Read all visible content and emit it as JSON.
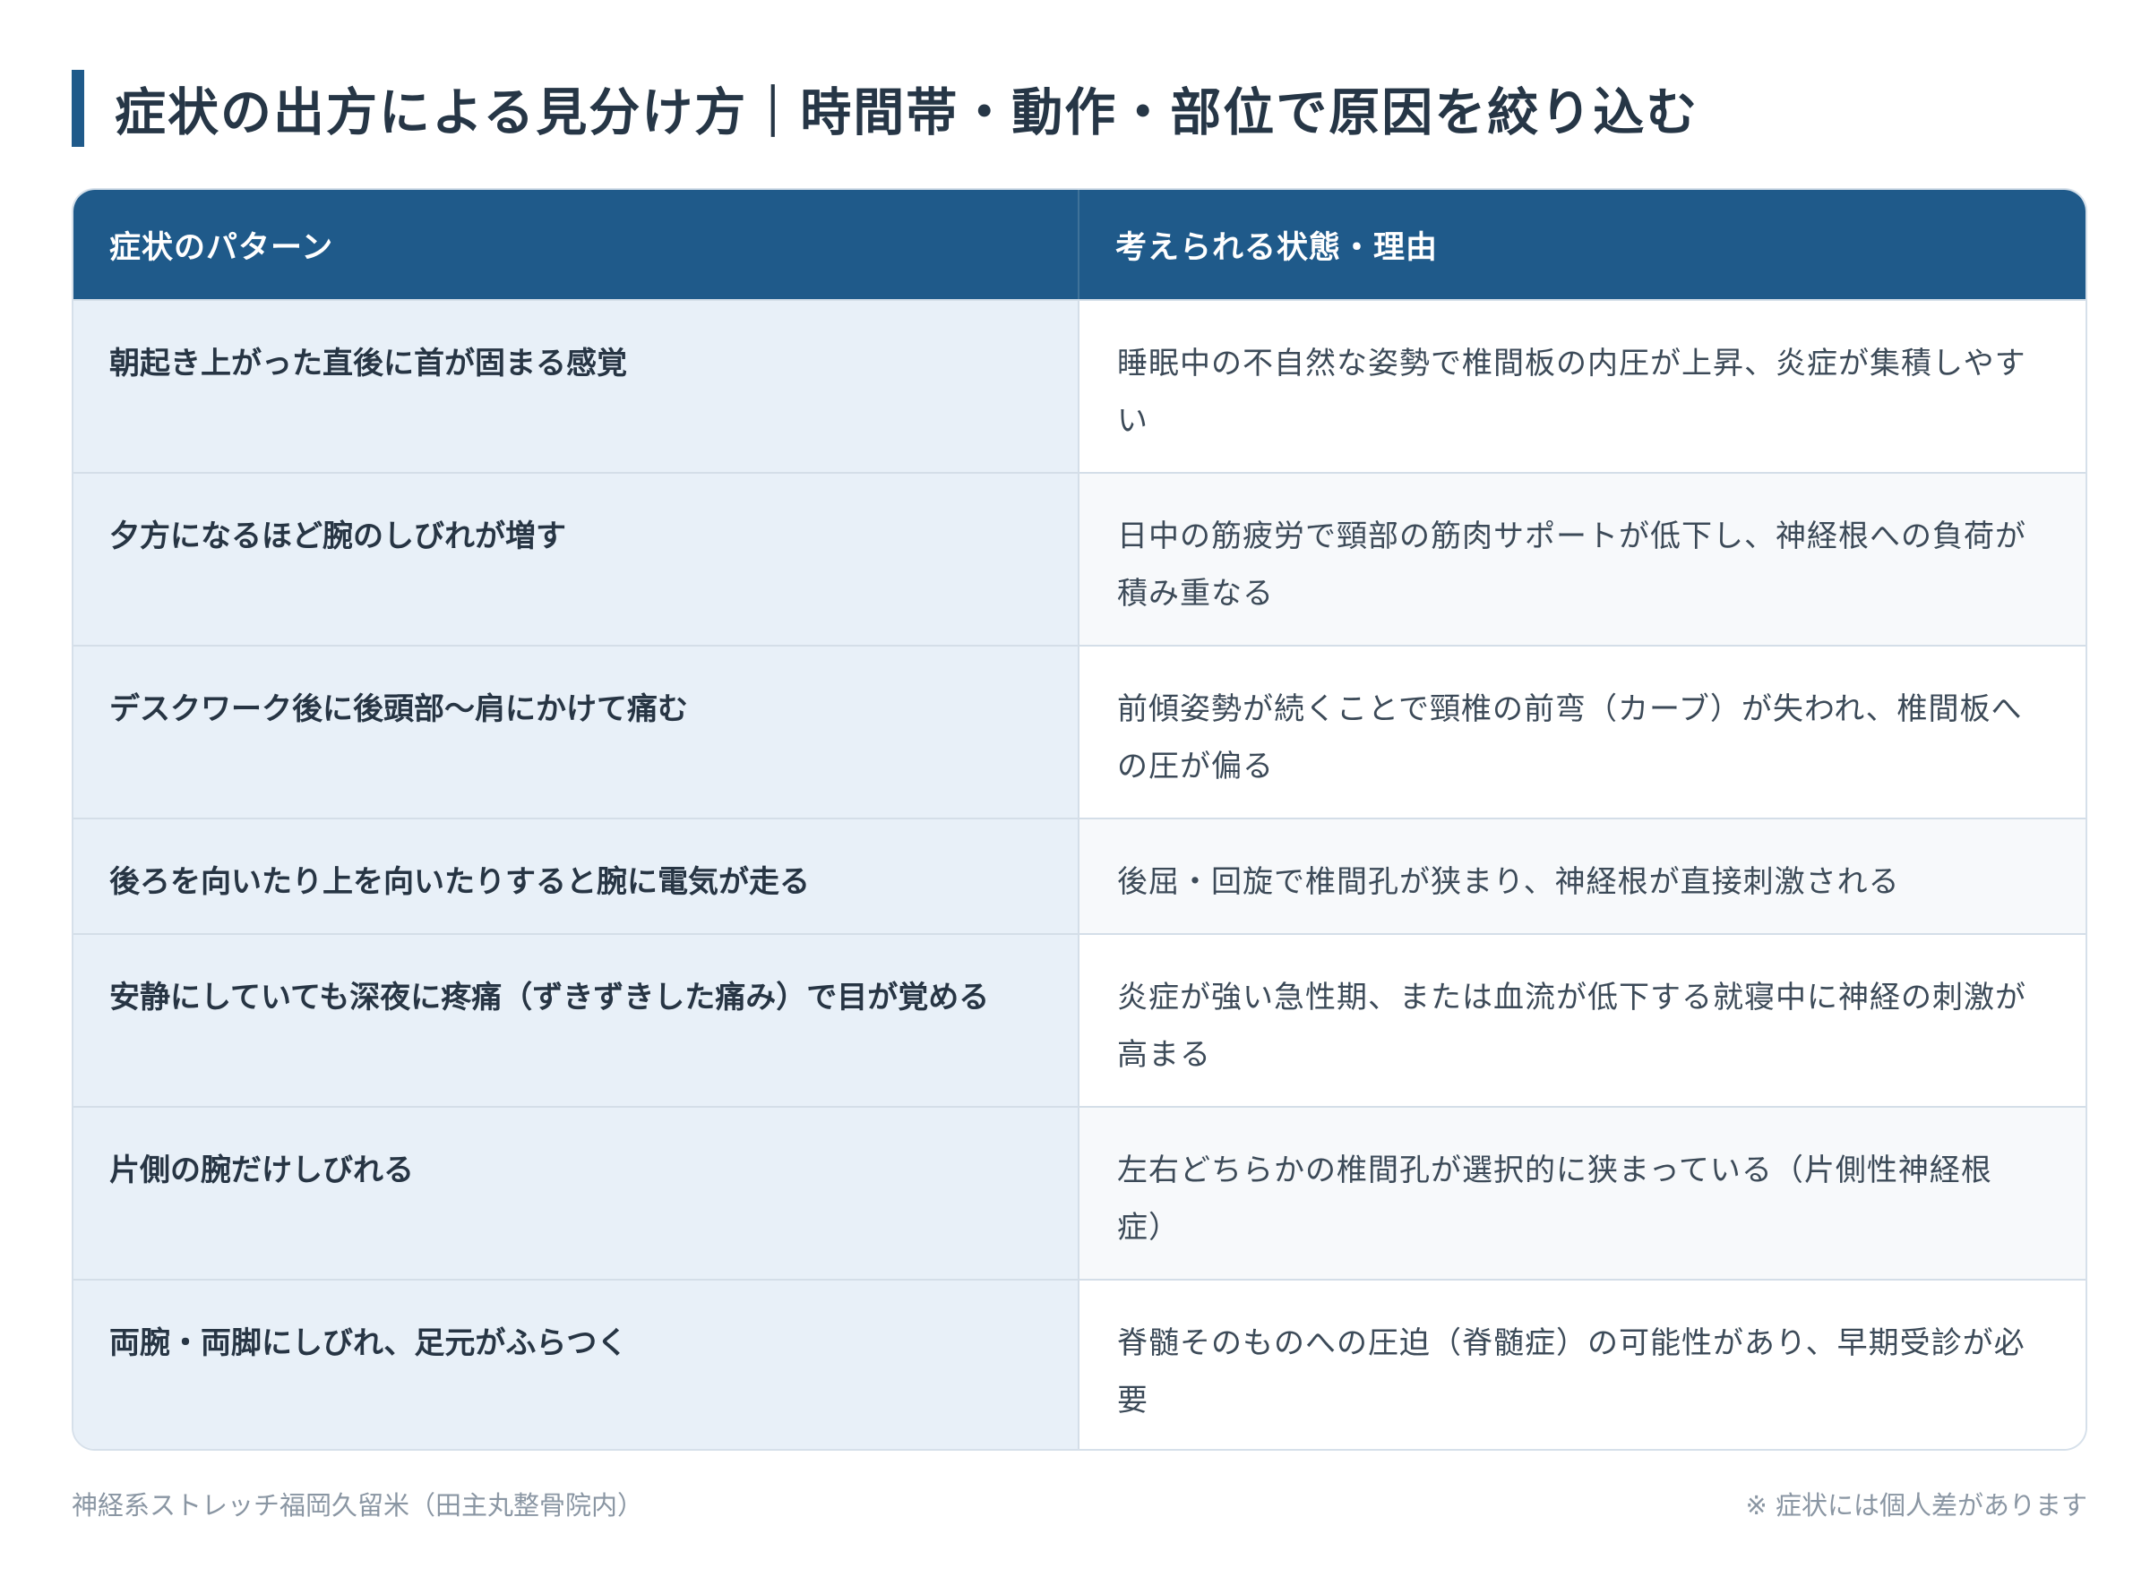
{
  "title": "症状の出方による見分け方｜時間帯・動作・部位で原因を絞り込む",
  "table": {
    "headers": [
      "症状のパターン",
      "考えられる状態・理由"
    ],
    "rows": [
      {
        "pattern": "朝起き上がった直後に首が固まる感覚",
        "reason": "睡眠中の不自然な姿勢で椎間板の内圧が上昇、炎症が集積しやすい"
      },
      {
        "pattern": "夕方になるほど腕のしびれが増す",
        "reason": "日中の筋疲労で頸部の筋肉サポートが低下し、神経根への負荷が積み重なる"
      },
      {
        "pattern": "デスクワーク後に後頭部〜肩にかけて痛む",
        "reason": "前傾姿勢が続くことで頸椎の前弯（カーブ）が失われ、椎間板への圧が偏る"
      },
      {
        "pattern": "後ろを向いたり上を向いたりすると腕に電気が走る",
        "reason": "後屈・回旋で椎間孔が狭まり、神経根が直接刺激される"
      },
      {
        "pattern": "安静にしていても深夜に疼痛（ずきずきした痛み）で目が覚める",
        "reason": "炎症が強い急性期、または血流が低下する就寝中に神経の刺激が高まる"
      },
      {
        "pattern": "片側の腕だけしびれる",
        "reason": "左右どちらかの椎間孔が選択的に狭まっている（片側性神経根症）"
      },
      {
        "pattern": "両腕・両脚にしびれ、足元がふらつく",
        "reason": "脊髄そのものへの圧迫（脊髄症）の可能性があり、早期受診が必要"
      }
    ]
  },
  "footer": {
    "source": "神経系ストレッチ福岡久留米（田主丸整骨院内）",
    "note": "※ 症状には個人差があります"
  },
  "colors": {
    "header_bg": "#1f5a8a",
    "accent_bar": "#1f5a8a",
    "pattern_cell_bg": "#e8f0f8"
  }
}
